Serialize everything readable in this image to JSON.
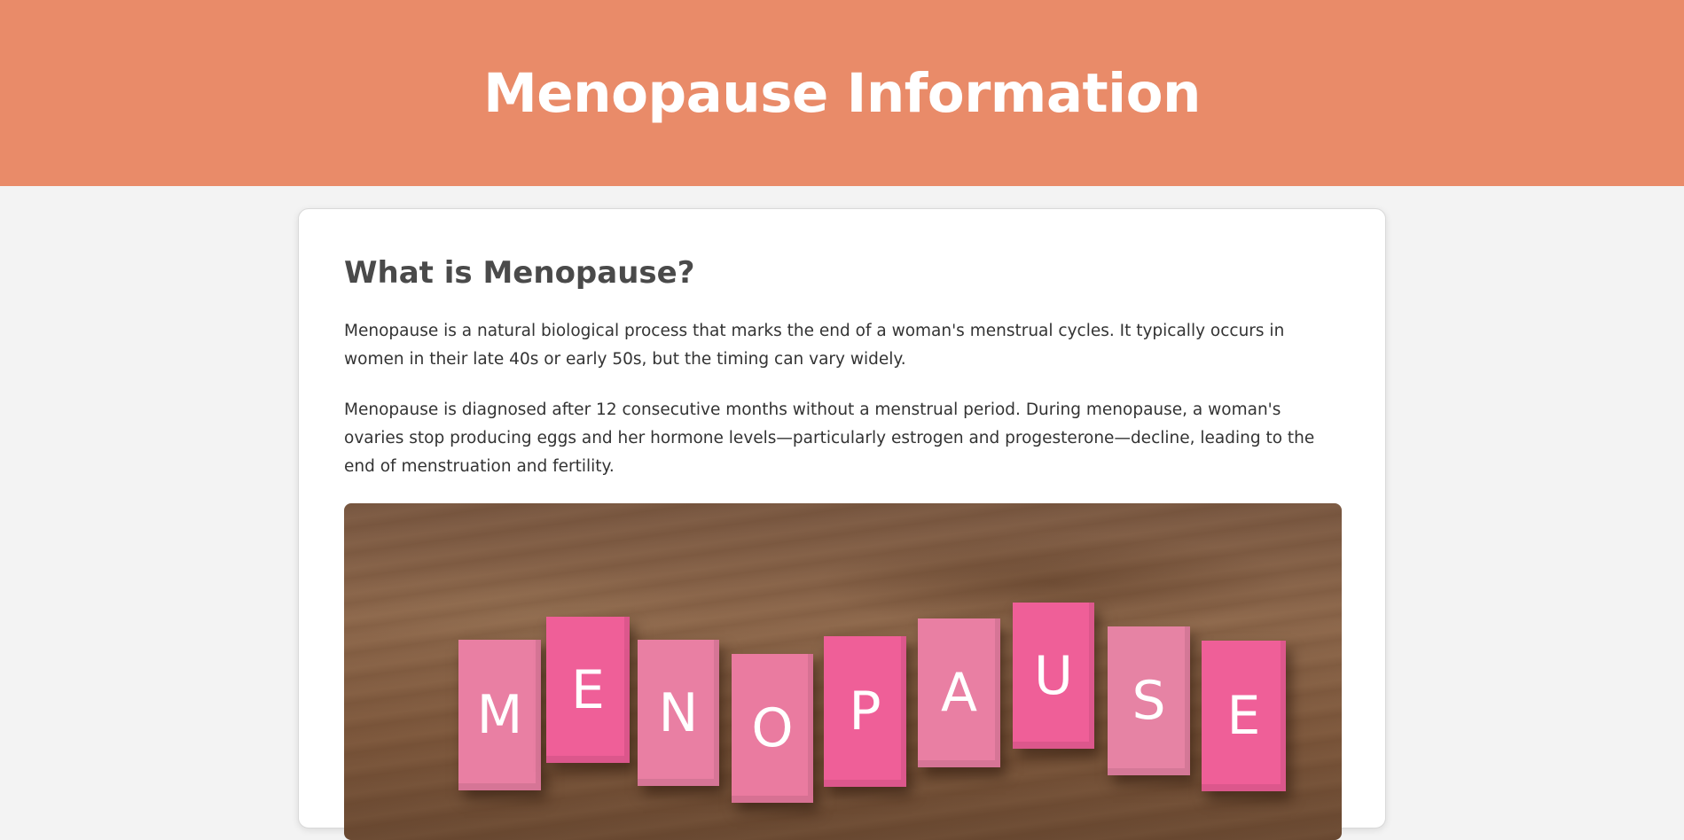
{
  "header": {
    "title": "Menopause Information"
  },
  "section": {
    "heading": "What is Menopause?",
    "paragraphs": [
      "Menopause is a natural biological process that marks the end of a woman's menstrual cycles. It typically occurs in women in their late 40s or early 50s, but the timing can vary widely.",
      "Menopause is diagnosed after 12 consecutive months without a menstrual period. During menopause, a woman's ovaries stop producing eggs and her hormone levels—particularly estrogen and progesterone—decline, leading to the end of menstruation and fertility."
    ]
  },
  "image": {
    "tiles": [
      "M",
      "E",
      "N",
      "O",
      "P",
      "A",
      "U",
      "S",
      "E"
    ],
    "tile_colors": [
      "#e97fa3",
      "#ef5f98",
      "#e97fa3",
      "#ea7ba0",
      "#ef5f98",
      "#e97fa3",
      "#ef5f98",
      "#e683a4",
      "#ef5f98"
    ]
  },
  "colors": {
    "header_bg": "#e98b69",
    "page_bg": "#f3f3f3",
    "card_bg": "#ffffff"
  }
}
